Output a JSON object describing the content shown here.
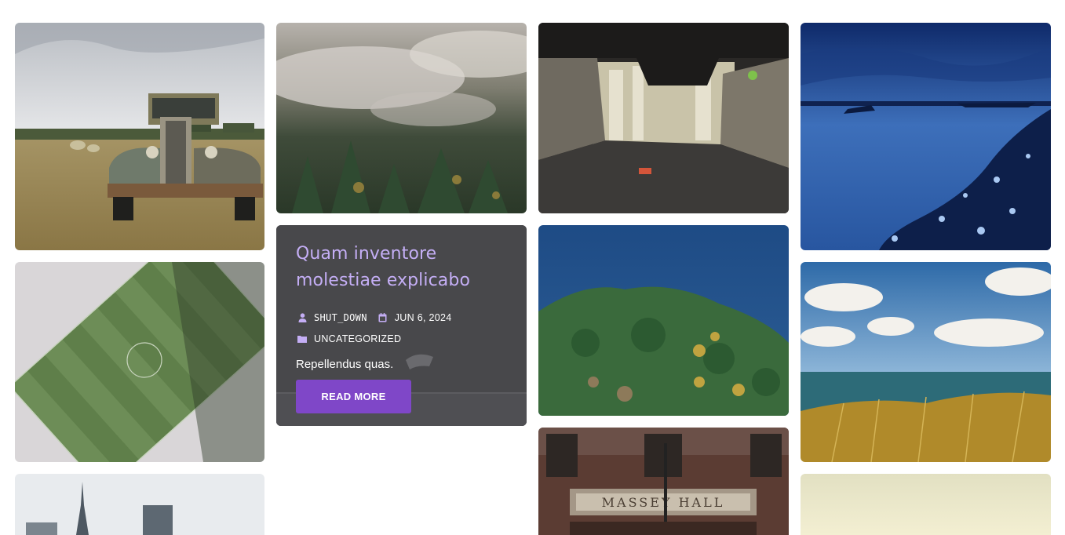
{
  "post": {
    "title": "Quam inventore molestiae explicabo",
    "author": "shut_down",
    "date": "Jun 6, 2024",
    "category": "Uncategorized",
    "excerpt": "Repellendus quas.",
    "read_more_label": "Read More"
  },
  "icons": {
    "author": "user-icon",
    "date": "calendar-icon",
    "category": "folder-icon"
  },
  "colors": {
    "accent": "#7f47c8",
    "title": "#c4aef5",
    "card_bg": "#4a4a4d"
  },
  "gallery": {
    "col1": [
      "rusty-truck-photo",
      "aerial-soccer-field-photo",
      "city-skyline-photo"
    ],
    "col2": [
      "misty-forest-photo"
    ],
    "col3": [
      "wooden-tunnel-photo",
      "aerial-forest-island-photo",
      "massey-hall-photo"
    ],
    "col4": [
      "blue-coast-photo",
      "ocean-cliff-photo",
      "hazy-sky-photo"
    ]
  },
  "sign_text": "MASSEY HALL"
}
